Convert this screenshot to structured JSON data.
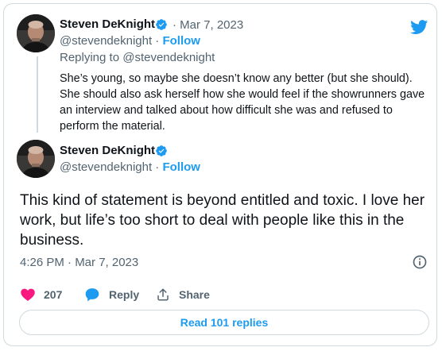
{
  "reply_tweet": {
    "author_name": "Steven DeKnight",
    "separator_date": "· Mar 7, 2023",
    "handle": "@stevendeknight",
    "handle_sep": " · ",
    "follow_label": "Follow",
    "replying_prefix": "Replying to ",
    "replying_handle": "@stevendeknight",
    "text": "She’s young, so maybe she doesn’t know any better (but she should). She should also ask herself how she would feel if the showrunners gave an interview and talked about how difficult she was and refused to perform the material."
  },
  "main_tweet": {
    "author_name": "Steven DeKnight",
    "handle": "@stevendeknight",
    "handle_sep": " · ",
    "follow_label": "Follow",
    "text": "This kind of statement is beyond entitled and toxic. I love her work, but life’s too short to deal with people like this in the business.",
    "timestamp": "4:26 PM · Mar 7, 2023"
  },
  "actions": {
    "likes_count": "207",
    "reply_label": "Reply",
    "share_label": "Share"
  },
  "read_replies_label": "Read 101 replies",
  "icons": {
    "brand": "twitter-bird-icon",
    "verified": "verified-badge-icon",
    "like": "heart-icon",
    "reply": "speech-bubble-icon",
    "share": "share-icon",
    "info": "info-icon"
  },
  "colors": {
    "accent": "#1d9bf0",
    "like": "#f91880",
    "text": "#0f1419",
    "muted": "#536471",
    "border": "#cfd9de"
  }
}
